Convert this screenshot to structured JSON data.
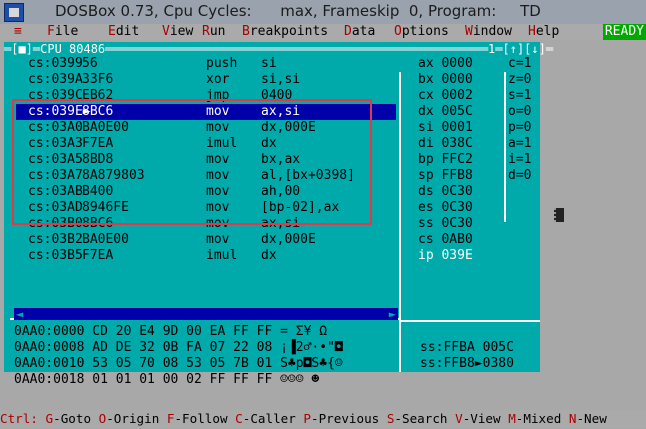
{
  "window": {
    "title": "DOSBox 0.73, Cpu Cycles:      max, Frameskip  0, Program:     TD"
  },
  "menu": {
    "items": [
      {
        "hk": "≡",
        "rest": ""
      },
      {
        "hk": "F",
        "rest": "ile"
      },
      {
        "hk": "E",
        "rest": "dit"
      },
      {
        "hk": "V",
        "rest": "iew"
      },
      {
        "hk": "R",
        "rest": "un"
      },
      {
        "hk": "B",
        "rest": "reakpoints"
      },
      {
        "hk": "D",
        "rest": "ata"
      },
      {
        "hk": "O",
        "rest": "ptions"
      },
      {
        "hk": "W",
        "rest": "indow"
      },
      {
        "hk": "H",
        "rest": "elp"
      }
    ],
    "status": "READY"
  },
  "cpu_panel": {
    "title": "═[■]═CPU 80486═════════════════════════════════════════════════════1═[↑][↓]═",
    "code": [
      {
        "addr": "cs:0399",
        "hex": "56",
        "mnem": "push",
        "ops": "si"
      },
      {
        "addr": "cs:039A",
        "hex": "33F6",
        "mnem": "xor",
        "ops": "si,si"
      },
      {
        "addr": "cs:039C",
        "hex": "EB62",
        "mnem": "jmp",
        "ops": "0400"
      },
      {
        "addr": "cs:039E",
        "hex": "8BC6",
        "mnem": "mov",
        "ops": "ax,si",
        "selected": true
      },
      {
        "addr": "cs:03A0",
        "hex": "BA0E00",
        "mnem": "mov",
        "ops": "dx,000E"
      },
      {
        "addr": "cs:03A3",
        "hex": "F7EA",
        "mnem": "imul",
        "ops": "dx"
      },
      {
        "addr": "cs:03A5",
        "hex": "8BD8",
        "mnem": "mov",
        "ops": "bx,ax"
      },
      {
        "addr": "cs:03A7",
        "hex": "8A879803",
        "mnem": "mov",
        "ops": "al,[bx+0398]"
      },
      {
        "addr": "cs:03AB",
        "hex": "B400",
        "mnem": "mov",
        "ops": "ah,00"
      },
      {
        "addr": "cs:03AD",
        "hex": "8946FE",
        "mnem": "mov",
        "ops": "[bp-02],ax"
      },
      {
        "addr": "cs:03B0",
        "hex": "8BC6",
        "mnem": "mov",
        "ops": "ax,si"
      },
      {
        "addr": "cs:03B2",
        "hex": "BA0E00",
        "mnem": "mov",
        "ops": "dx,000E"
      },
      {
        "addr": "cs:03B5",
        "hex": "F7EA",
        "mnem": "imul",
        "ops": "dx"
      }
    ],
    "registers": [
      {
        "name": "ax",
        "value": "0000"
      },
      {
        "name": "bx",
        "value": "0000"
      },
      {
        "name": "cx",
        "value": "0002"
      },
      {
        "name": "dx",
        "value": "005C"
      },
      {
        "name": "si",
        "value": "0001"
      },
      {
        "name": "di",
        "value": "038C"
      },
      {
        "name": "bp",
        "value": "FFC2"
      },
      {
        "name": "sp",
        "value": "FFB8"
      },
      {
        "name": "ds",
        "value": "0C30"
      },
      {
        "name": "es",
        "value": "0C30"
      },
      {
        "name": "ss",
        "value": "0C30"
      },
      {
        "name": "cs",
        "value": "0AB0"
      },
      {
        "name": "ip",
        "value": "039E"
      }
    ],
    "flags": [
      {
        "name": "c",
        "value": "1"
      },
      {
        "name": "z",
        "value": "0"
      },
      {
        "name": "s",
        "value": "1"
      },
      {
        "name": "o",
        "value": "0"
      },
      {
        "name": "p",
        "value": "0"
      },
      {
        "name": "a",
        "value": "1"
      },
      {
        "name": "i",
        "value": "1"
      },
      {
        "name": "d",
        "value": "0"
      }
    ],
    "dump": [
      "0AA0:0000 CD 20 E4 9D 00 EA FF FF = Σ¥ Ω",
      "0AA0:0008 AD DE 32 0B FA 07 22 08 ¡▐2♂·•\"◘",
      "0AA0:0010 53 05 70 08 53 05 7B 01 S♣p◘S♣{☺",
      "0AA0:0018 01 01 01 00 02 FF FF FF ☺☺☺ ☻"
    ],
    "stack": [
      "ss:FFBA 005C",
      "ss:FFB8►0380"
    ]
  },
  "hotkey_bar": [
    {
      "key": "Ctrl:",
      "label": ""
    },
    {
      "key": "G",
      "label": "-Goto"
    },
    {
      "key": "O",
      "label": "-Origin"
    },
    {
      "key": "F",
      "label": "-Follow"
    },
    {
      "key": "C",
      "label": "-Caller"
    },
    {
      "key": "P",
      "label": "-Previous"
    },
    {
      "key": "S",
      "label": "-Search"
    },
    {
      "key": "V",
      "label": "-View"
    },
    {
      "key": "M",
      "label": "-Mixed"
    },
    {
      "key": "N",
      "label": "-New"
    }
  ]
}
